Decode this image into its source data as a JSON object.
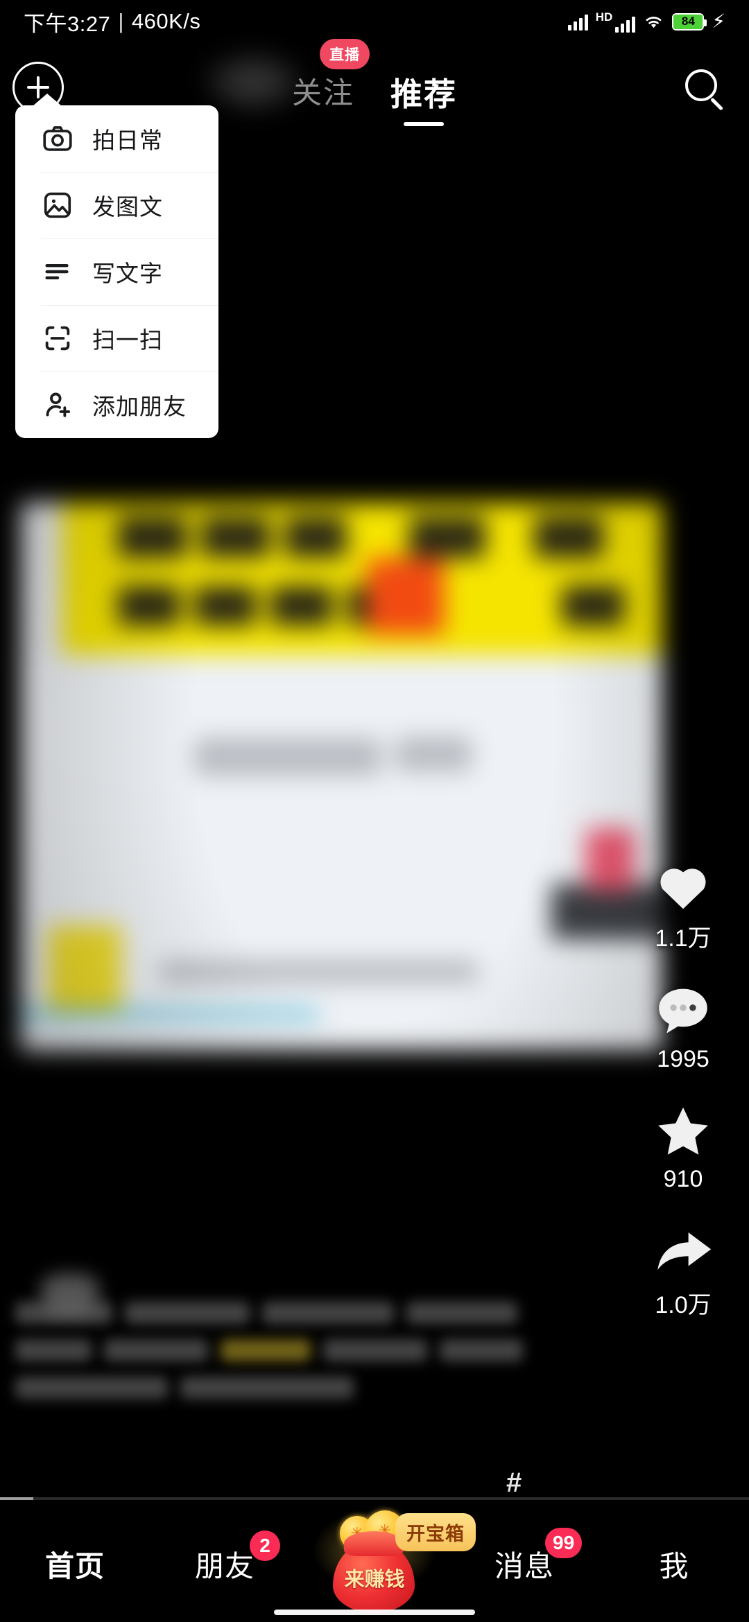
{
  "status_bar": {
    "time": "下午3:27",
    "separator": "|",
    "network_speed": "460K/s",
    "hd_label": "HD",
    "battery_level": "84",
    "charging_icon": "bolt-icon",
    "signal_icon": "signal-bars-icon",
    "wifi_icon": "wifi-icon"
  },
  "top_nav": {
    "create_button_icon": "plus-circle-icon",
    "search_icon": "search-icon",
    "tabs": [
      {
        "label": "关注",
        "active": false,
        "badge": "直播"
      },
      {
        "label": "推荐",
        "active": true,
        "badge": ""
      }
    ]
  },
  "create_menu": {
    "items": [
      {
        "label": "拍日常",
        "icon": "camera-icon"
      },
      {
        "label": "发图文",
        "icon": "image-icon"
      },
      {
        "label": "写文字",
        "icon": "text-lines-icon"
      },
      {
        "label": "扫一扫",
        "icon": "scan-icon"
      },
      {
        "label": "添加朋友",
        "icon": "add-friend-icon"
      }
    ]
  },
  "action_rail": {
    "items": [
      {
        "icon": "heart-icon",
        "count": "1.1万",
        "name": "like"
      },
      {
        "icon": "comment-icon",
        "count": "1995",
        "name": "comment"
      },
      {
        "icon": "star-icon",
        "count": "910",
        "name": "favorite"
      },
      {
        "icon": "share-icon",
        "count": "1.0万",
        "name": "share"
      }
    ]
  },
  "caption": {
    "hashtag_symbol": "#"
  },
  "bottom_nav": {
    "items": [
      {
        "label": "首页",
        "active": true,
        "badge": ""
      },
      {
        "label": "朋友",
        "active": false,
        "badge": "2"
      },
      {
        "label": "来赚钱",
        "active": false,
        "badge": "",
        "tooltip": "开宝箱",
        "is_money_bag": true
      },
      {
        "label": "消息",
        "active": false,
        "badge": "99"
      },
      {
        "label": "我",
        "active": false,
        "badge": ""
      }
    ]
  },
  "colors": {
    "accent_red": "#fa2c55",
    "live_badge": "#f04860",
    "tooltip_gold": "#f6c35a",
    "battery_green": "#4cd137",
    "menu_bg": "#ffffff",
    "text_primary": "#ffffff",
    "tab_inactive": "#8e8e8e"
  }
}
